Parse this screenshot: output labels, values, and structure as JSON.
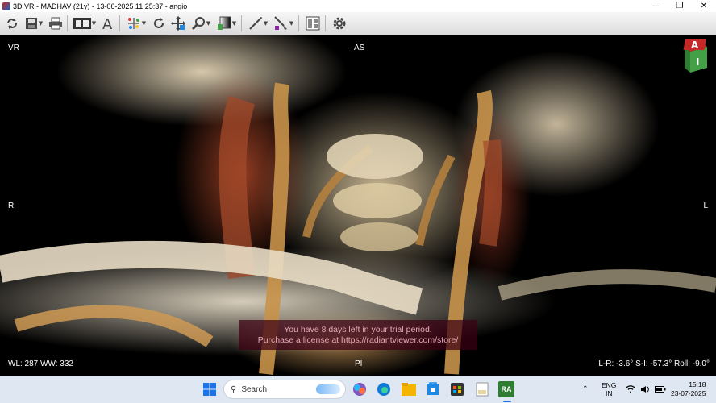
{
  "window": {
    "title": "3D VR - MADHAV (21y) - 13-06-2025 11:25:37 - angio",
    "minimize": "—",
    "maximize": "❐",
    "close": "✕"
  },
  "toolbar": {
    "items": [
      "refresh-icon",
      "save-icon",
      "print-icon",
      "film-icon",
      "text-annotation-icon",
      "scatter-tool-icon",
      "rotate-icon",
      "pan-icon",
      "zoom-icon",
      "window-level-icon",
      "measure-icon",
      "scalpel-icon",
      "layout-icon",
      "settings-icon"
    ]
  },
  "viewport": {
    "top_left": "VR",
    "top_center": "AS",
    "left": "R",
    "right": "L",
    "bottom_left": "WL: 287 WW: 332",
    "bottom_center": "PI",
    "bottom_right": "L-R: -3.6° S-I: -57.3° Roll: -9.0°",
    "orientation_cube": {
      "top": "A",
      "front": "I"
    },
    "trial_line1": "You have 8 days left in your trial period.",
    "trial_line2": "Purchase a license at https://radiantviewer.com/store/"
  },
  "taskbar": {
    "search_placeholder": "Search",
    "apps": [
      "windows-start-icon",
      "copilot-icon",
      "edge-icon",
      "file-explorer-icon",
      "store-icon",
      "ms-store-icon",
      "notepad-icon",
      "radiant-icon"
    ],
    "radiant_label": "RA",
    "language_top": "ENG",
    "language_bottom": "IN",
    "time": "15:18",
    "date": "23-07-2025"
  },
  "colors": {
    "trial_bg": "#3c0014",
    "trial_text": "#e5a8b5",
    "taskbar_bg": "#dfe7f2"
  }
}
